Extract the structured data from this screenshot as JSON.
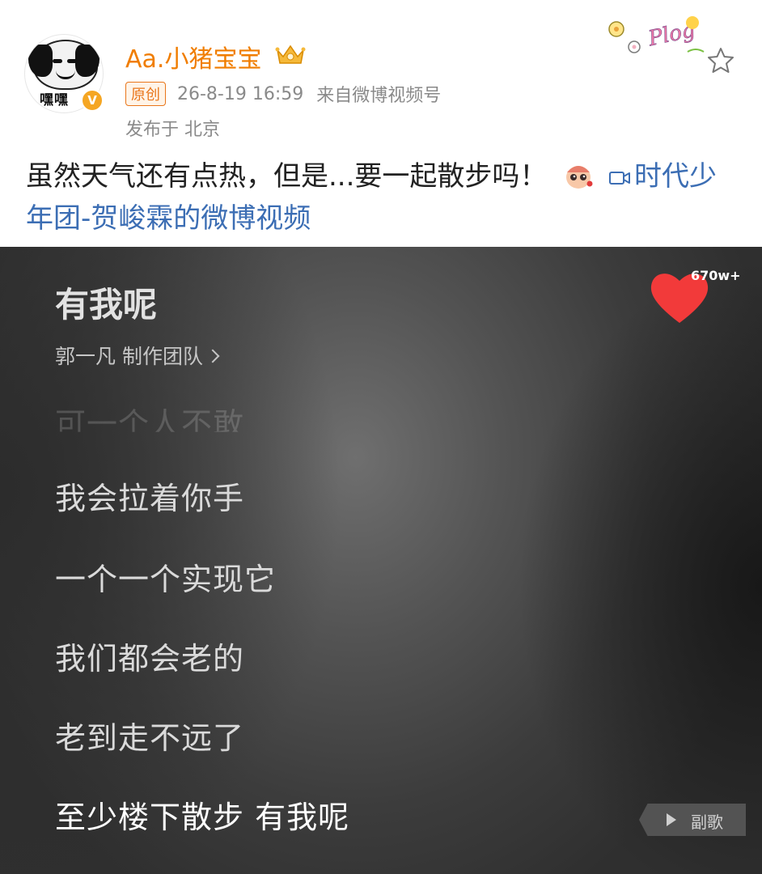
{
  "post": {
    "username": "Aa.小猪宝宝",
    "avatar_caption": "嘿嘿",
    "verified_badge": "V",
    "original_tag": "原创",
    "timestamp": "26-8-19 16:59",
    "source": "来自微博视频号",
    "location": "发布于 北京",
    "text": "虽然天气还有点热，但是...要一起散步吗！",
    "video_link": "时代少年团-贺峻霖的微博视频",
    "decorations": {
      "plog_sticker": "Plog",
      "crown_icon": "crown-icon"
    }
  },
  "video": {
    "song_title": "有我呢",
    "credits": "郭一凡  制作团队",
    "likes": "670w+",
    "lyrics": {
      "faded": "可一个人不敢",
      "lines": [
        "我会拉着你手",
        "一个一个实现它",
        "我们都会老的",
        "老到走不远了"
      ],
      "active": "至少楼下散步 有我呢"
    },
    "chorus_button": "副歌"
  },
  "colors": {
    "username": "#f07d00",
    "link": "#3c6eb4",
    "meta": "#8a8a8a",
    "heart": "#f23a3a"
  }
}
